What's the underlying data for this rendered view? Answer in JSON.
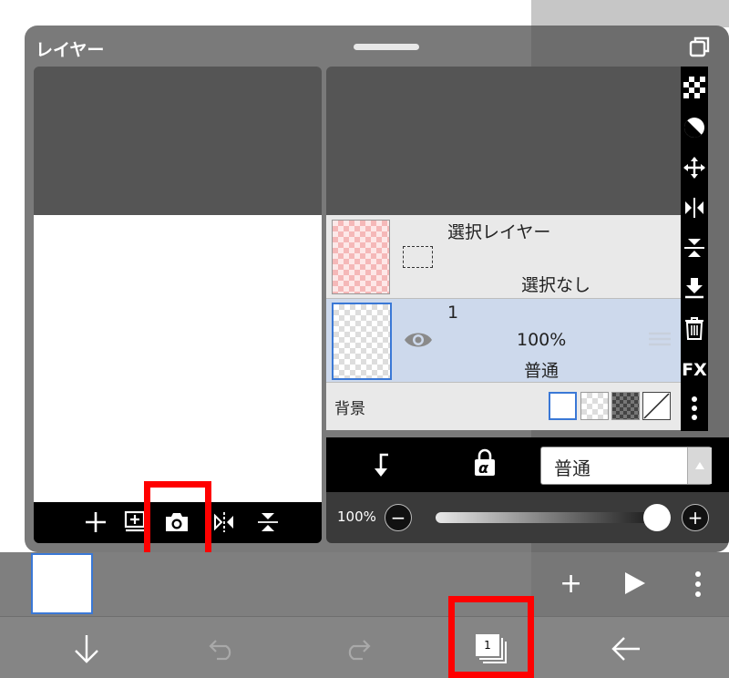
{
  "panel": {
    "title": "レイヤー",
    "window_icon": "window-restore-icon"
  },
  "preview": {
    "toolbar_icons": [
      "plus-icon",
      "add-layer-icon",
      "camera-icon",
      "flip-horizontal-icon",
      "flip-vertical-icon"
    ]
  },
  "layers": {
    "selection_layer": {
      "name": "選択レイヤー",
      "status": "選択なし"
    },
    "layer1": {
      "name": "1",
      "opacity": "100%",
      "blend": "普通",
      "visibility_icon": "eye-icon"
    },
    "background": {
      "label": "背景"
    }
  },
  "side_tools": [
    "checker-icon",
    "contrast-icon",
    "move-icon",
    "flip-horizontal-icon",
    "flip-vertical-icon",
    "merge-down-icon",
    "trash-icon",
    "FX",
    "more-vertical-icon"
  ],
  "blend": {
    "clip_icon": "clipping-icon",
    "lock_icon": "alpha-lock-icon",
    "lock_label": "α",
    "mode": "普通"
  },
  "opacity": {
    "label": "100%",
    "minus": "−",
    "plus": "+",
    "value": 1.0
  },
  "frame_bar": {
    "add": "+"
  },
  "nav": {
    "layer_count": "1"
  },
  "colors": {
    "highlight_red": "#ff0000",
    "selected_layer_bg": "#cdd9ec",
    "accent_blue": "#3a78d6"
  }
}
